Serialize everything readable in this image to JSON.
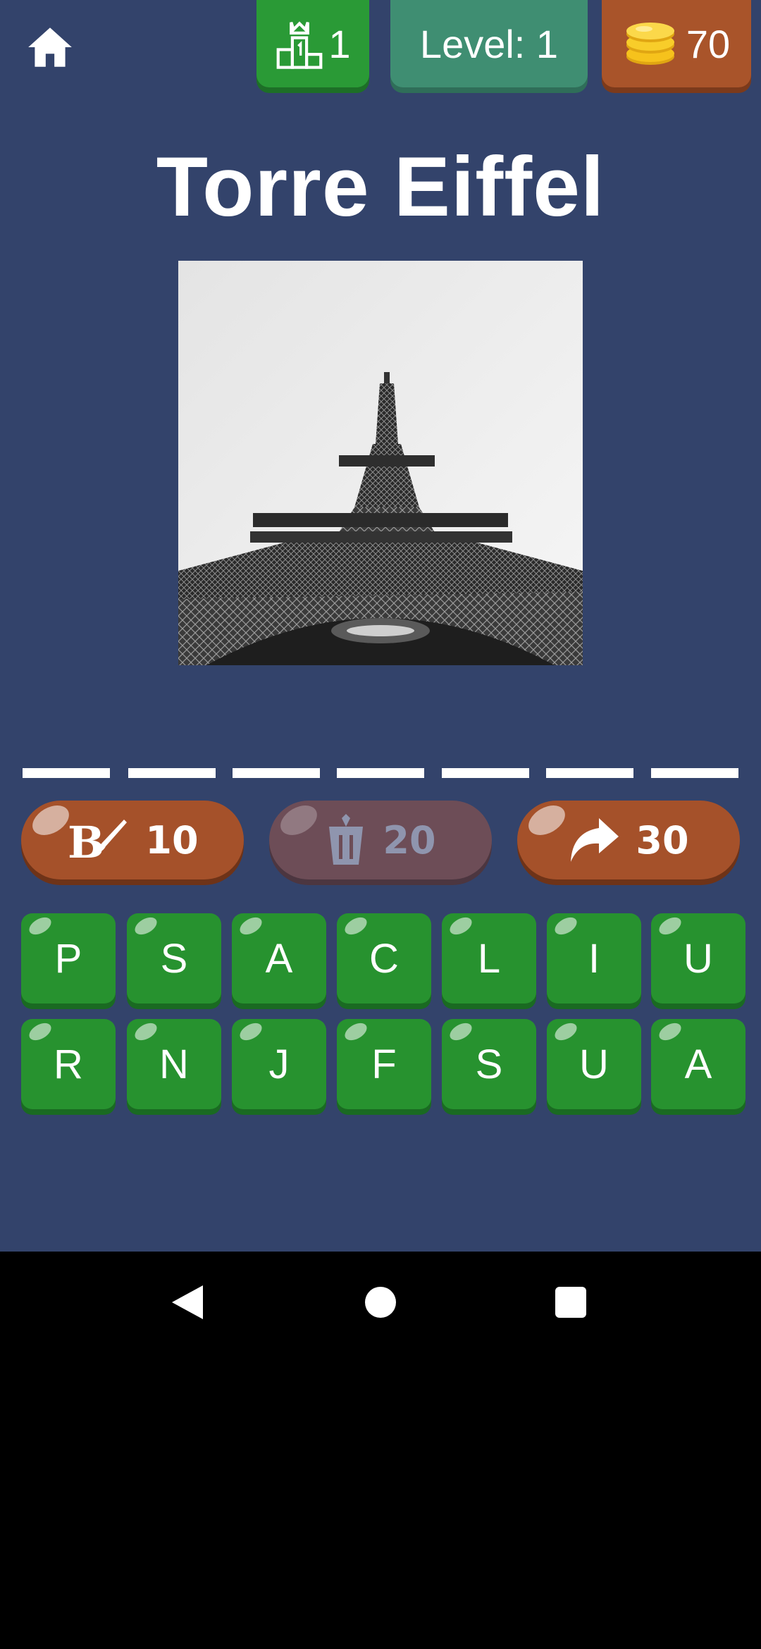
{
  "header": {
    "rank_value": "1",
    "level_label": "Level: 1",
    "coins_value": "70"
  },
  "puzzle": {
    "title": "Torre Eiffel",
    "image_subject": "eiffel-tower-photo",
    "answer_slots": 7
  },
  "powerups": [
    {
      "name": "reveal-letter",
      "icon": "paintbrush-icon",
      "cost": "10",
      "enabled": true
    },
    {
      "name": "remove-letters",
      "icon": "trash-icon",
      "cost": "20",
      "enabled": false
    },
    {
      "name": "skip",
      "icon": "arrow-right-icon",
      "cost": "30",
      "enabled": true
    }
  ],
  "letters": {
    "row1": [
      "P",
      "S",
      "A",
      "C",
      "L",
      "I",
      "U"
    ],
    "row2": [
      "R",
      "N",
      "J",
      "F",
      "S",
      "U",
      "A"
    ]
  },
  "colors": {
    "background": "#33436b",
    "tile_green": "#27922f",
    "powerup_orange": "#a5512a",
    "level_teal": "#3f8e72",
    "coins_orange": "#a9542a"
  }
}
